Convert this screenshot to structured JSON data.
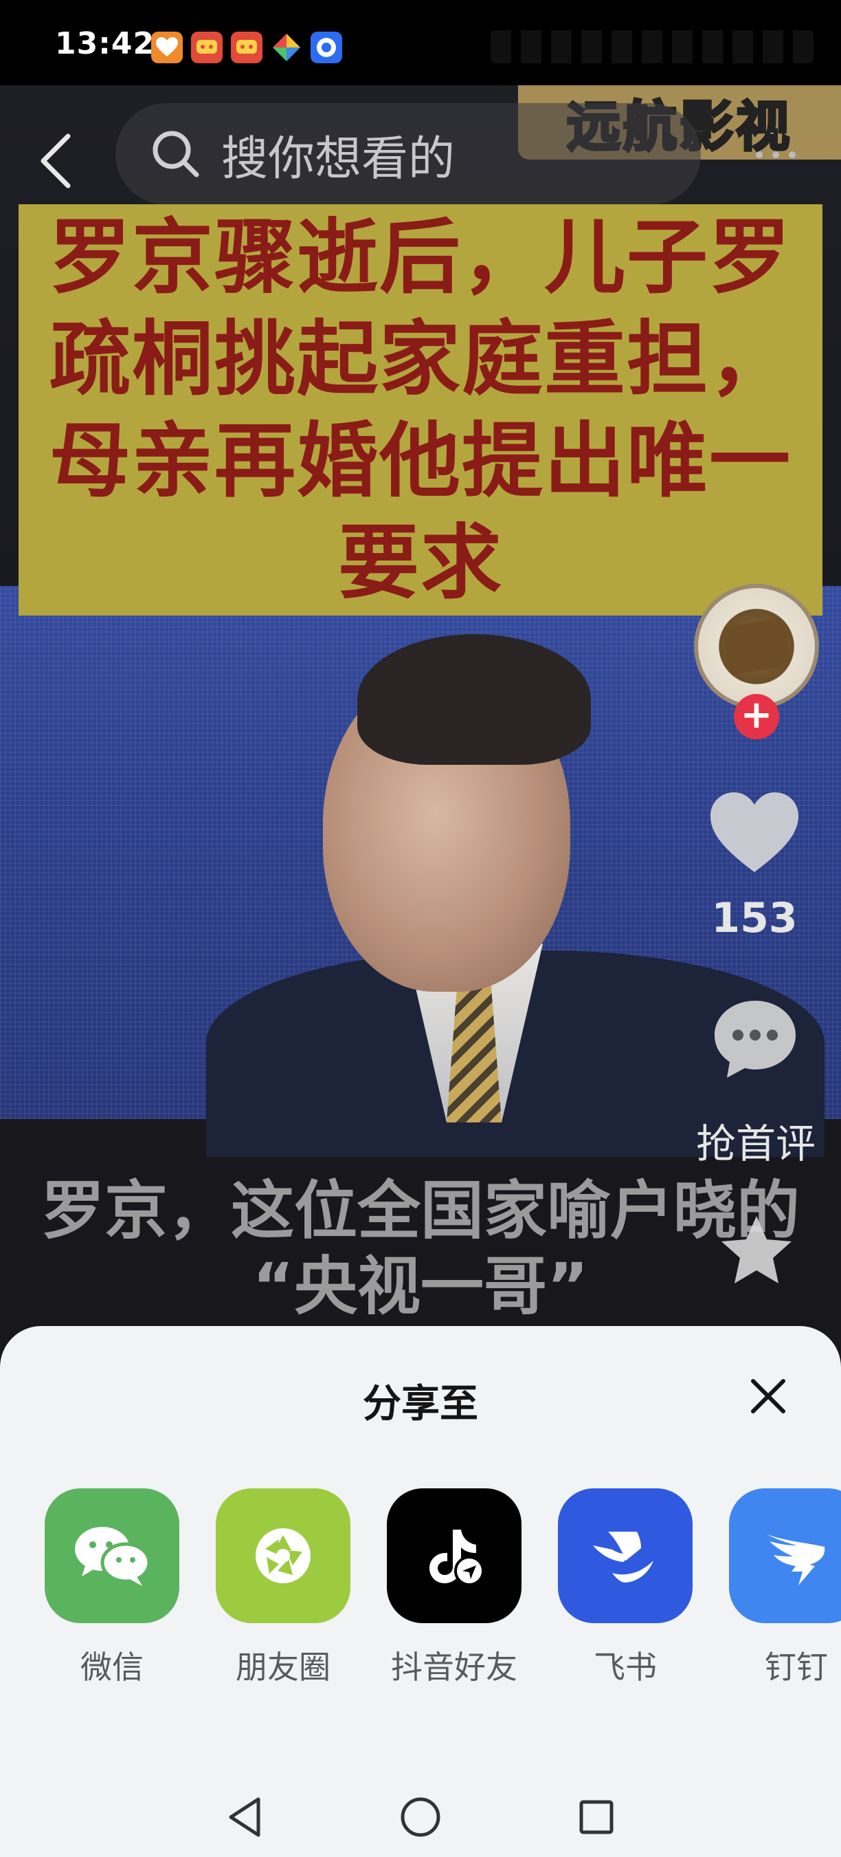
{
  "status_bar": {
    "time": "13:42",
    "notification_icons": [
      "heart-app-icon",
      "red-app-icon",
      "red-app-icon",
      "color-wheel-app-icon",
      "blue-app-icon"
    ]
  },
  "top_bar": {
    "search_placeholder": "搜你想看的",
    "watermark": "远航影视"
  },
  "video": {
    "title_card": "罗京骤逝后，儿子罗疏桐挑起家庭重担，母亲再婚他提出唯一要求",
    "subtitle_line1": "罗京，这位全国家喻户晓的",
    "subtitle_line2": "“央视一哥”"
  },
  "actions": {
    "follow_symbol": "+",
    "like_count": "153",
    "comment_label": "抢首评"
  },
  "share_sheet": {
    "title": "分享至",
    "targets": [
      {
        "label": "微信",
        "color": "#5ab45e"
      },
      {
        "label": "朋友圈",
        "color": "#9dcb40"
      },
      {
        "label": "抖音好友",
        "color": "#000000"
      },
      {
        "label": "飞书",
        "color": "#2f5ae0"
      },
      {
        "label": "钉钉",
        "color": "#3f86f0"
      }
    ]
  },
  "colors": {
    "title_card_bg": "#b4a63e",
    "title_card_text": "#8a1c17",
    "follow_badge": "#e63348",
    "sheet_bg": "#f2f3f5"
  }
}
